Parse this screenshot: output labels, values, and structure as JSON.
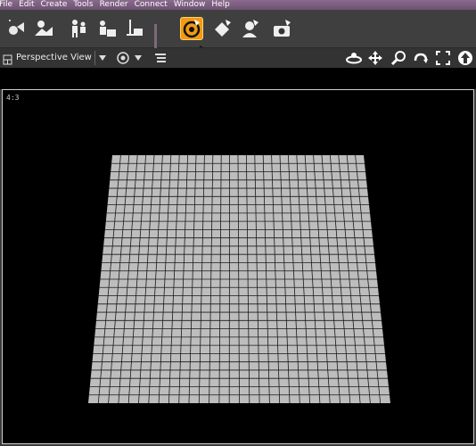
{
  "menubar": {
    "items": [
      "File",
      "Edit",
      "Create",
      "Tools",
      "Render",
      "Connect",
      "Window",
      "Help"
    ]
  },
  "toolbar": {
    "icons": [
      "new-light-icon",
      "scene-environment-icon",
      "figure-poses-icon",
      "import-object-icon",
      "export-object-icon",
      "render-settings-icon",
      "export-to-browser-icon",
      "figure-morph-icon",
      "camera-snapshot-icon"
    ],
    "active_icon": "render-settings-icon",
    "colors": {
      "active": "#f29a10",
      "menubar": "#7a5a7e"
    }
  },
  "viewbar": {
    "view_label": "Perspective View",
    "nav_icons": [
      "orbit-icon",
      "pan-icon",
      "zoom-icon",
      "rotate-icon",
      "frame-icon",
      "up-icon"
    ]
  },
  "viewport": {
    "aspect_label": "4:3",
    "plane_color": "#bdbdbd",
    "grid_line_color": "#1a1a1a"
  }
}
